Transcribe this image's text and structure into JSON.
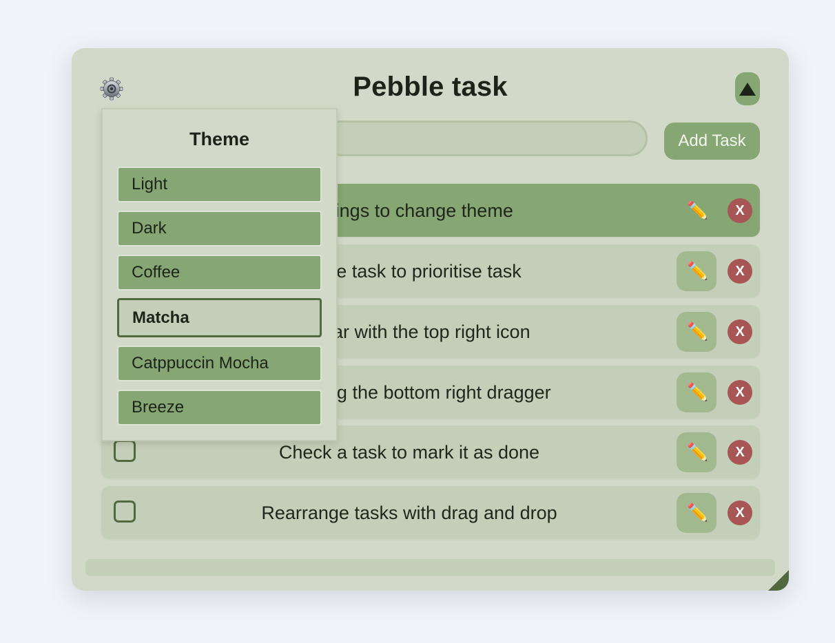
{
  "app": {
    "title": "Pebble task",
    "add_button_label": "Add Task",
    "input_value": "",
    "input_placeholder": ""
  },
  "tasks": [
    {
      "text": "Click on settings to change theme",
      "visible_text": "settings to change theme",
      "highlighted": true,
      "checked": false
    },
    {
      "text": "Double click the task to prioritise task",
      "visible_text": "ck the task to prioritise task",
      "highlighted": false,
      "checked": false
    },
    {
      "text": "Hide the taskbar with the top right icon",
      "visible_text": "taskbar with the top right icon",
      "highlighted": false,
      "checked": false
    },
    {
      "text": "Resize it by using the bottom right dragger",
      "visible_text": "t by using the bottom right dragger",
      "highlighted": false,
      "checked": false
    },
    {
      "text": "Check a task to mark it as done",
      "visible_text": "Check a task to mark it as done",
      "highlighted": false,
      "checked": false
    },
    {
      "text": "Rearrange tasks with drag and drop",
      "visible_text": "Rearrange tasks with drag and drop",
      "highlighted": false,
      "checked": false
    }
  ],
  "task_edit_icon": "✏️",
  "task_delete_label": "X",
  "theme_menu": {
    "title": "Theme",
    "options": [
      "Light",
      "Dark",
      "Coffee",
      "Matcha",
      "Catppuccin Mocha",
      "Breeze"
    ],
    "selected": "Matcha"
  },
  "colors": {
    "background": "#f0f3f8",
    "panel": "#d2d9c9",
    "accent": "#86a673",
    "task_bg": "#c4cfb9",
    "dark_green": "#52683f",
    "delete_red": "#a75555",
    "text": "#1d2319"
  },
  "icons": {
    "settings": "gear-icon",
    "collapse": "triangle-up-icon",
    "edit": "pencil-icon",
    "delete": "close-icon",
    "resize": "resize-corner-icon"
  }
}
